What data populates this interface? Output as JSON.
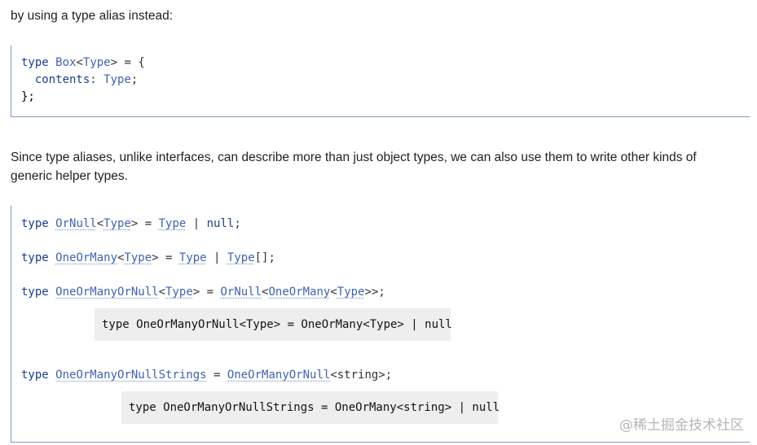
{
  "intro_text": "by using a type alias instead:",
  "code_block_1": {
    "lines": [
      [
        "type",
        " ",
        "Box",
        "<",
        "Type",
        "> = {"
      ],
      [
        "  ",
        "contents",
        ": ",
        "Type",
        ";"
      ],
      [
        "};"
      ]
    ],
    "line1": {
      "kw": "type",
      "name": "Box",
      "param": "Type",
      "rest": "> = {"
    },
    "line2": {
      "prop": "contents",
      "colon": ": ",
      "type": "Type",
      "end": ";"
    },
    "line3": {
      "text": "};"
    }
  },
  "middle_text": {
    "line1": "Since type aliases, unlike interfaces, can describe more than just object types, we can also use them to write other kinds of",
    "line2": "generic helper types."
  },
  "code_block_2": {
    "orNull": {
      "kw": "type",
      "name": "OrNull",
      "param": "Type",
      "eq": "> = ",
      "t1": "Type",
      "pipe": " | ",
      "t2": "null",
      "end": ";"
    },
    "oneOrMany": {
      "kw": "type",
      "name": "OneOrMany",
      "param": "Type",
      "eq": "> = ",
      "t1": "Type",
      "pipe": " | ",
      "t2": "Type",
      "end": "[];"
    },
    "oneOrManyOrNull": {
      "kw": "type",
      "name": "OneOrManyOrNull",
      "param": "Type",
      "eq": "> = ",
      "ref1": "OrNull",
      "ref2": "OneOrMany",
      "ref3": "Type",
      "end": ">>;"
    },
    "popup1": "type OneOrManyOrNull<Type> = OneOrMany<Type> | null",
    "oneOrManyOrNullStrings": {
      "kw": "type",
      "name": "OneOrManyOrNullStrings",
      "eq": " = ",
      "ref": "OneOrManyOrNull",
      "arg": "<string>;"
    },
    "popup2": "type OneOrManyOrNullStrings = OneOrMany<string> | null"
  },
  "watermark": "@稀土掘金技术社区",
  "colors": {
    "keyword": "#1a3d8f",
    "type": "#3e64b0",
    "block_border": "#7b99c4",
    "popup_bg": "#eeeeee",
    "watermark": "#b6b6b6"
  }
}
